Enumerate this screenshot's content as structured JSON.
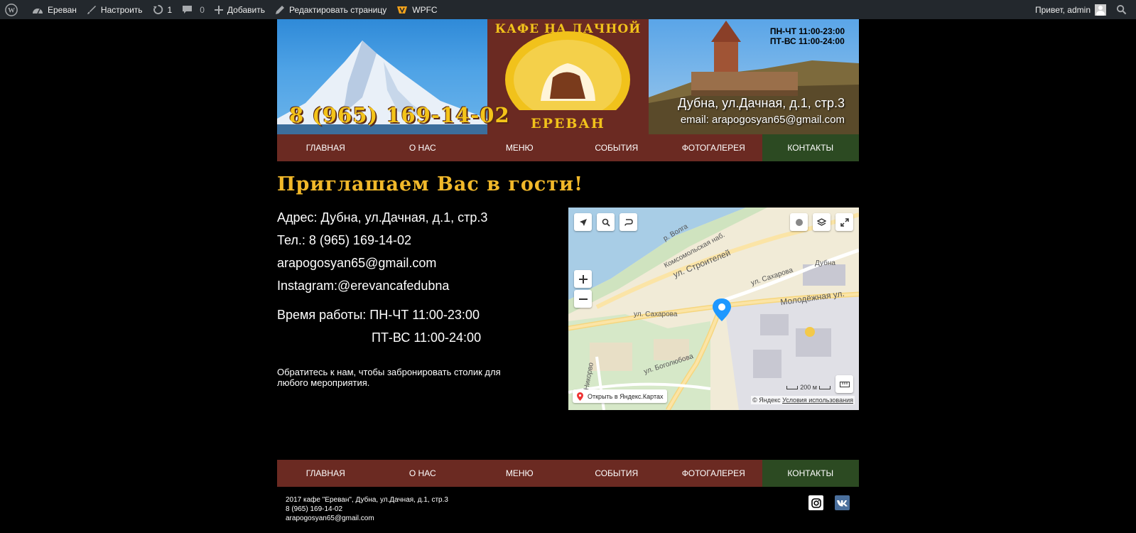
{
  "adminbar": {
    "site_name": "Ереван",
    "customize": "Настроить",
    "updates": "1",
    "comments": "0",
    "add_new": "Добавить",
    "edit_page": "Редактировать страницу",
    "plugin": "WPFC",
    "greeting": "Привет, admin"
  },
  "header": {
    "phone": "8 (965) 169-14-02",
    "hours_weekdays": "ПН-ЧТ 11:00-23:00",
    "hours_weekend": "ПТ-ВС 11:00-24:00",
    "address": "Дубна, ул.Дачная, д.1, стр.3",
    "email": "email: arapogosyan65@gmail.com",
    "emblem_title": "КАФЕ НА ДАЧНОЙ",
    "emblem_name": "ЕРЕВАН"
  },
  "nav": {
    "items": [
      "ГЛАВНАЯ",
      "О НАС",
      "МЕНЮ",
      "СОБЫТИЯ",
      "ФОТОГАЛЕРЕЯ",
      "КОНТАКТЫ"
    ],
    "active": "КОНТАКТЫ"
  },
  "content": {
    "heading": "Приглашаем Вас в гости!",
    "address": "Адрес: Дубна, ул.Дачная, д.1, стр.3",
    "phone": "Тел.: 8 (965) 169-14-02",
    "email": "arapogosyan65@gmail.com",
    "instagram": "Instagram:@erevancafedubna",
    "hours_line1": "Время работы: ПН-ЧТ 11:00-23:00",
    "hours_line2": "ПТ-ВС 11:00-24:00",
    "note": "Обратитесь к нам, чтобы забронировать столик для любого мероприятия."
  },
  "map": {
    "labels": {
      "komsomolskaya": "Комсомольская наб.",
      "stroiteley": "ул. Строителей",
      "sakharova_top": "ул. Сахарова",
      "molodezhnaya": "Молодёжная ул.",
      "sakharova_left": "ул. Сахарова",
      "bogolyubova": "ул. Боголюбова",
      "dubna": "Дубна",
      "volga": "р. Волга",
      "side_street": "ул. Никорво"
    },
    "open_link": "Открыть в Яндекс.Картах",
    "copyright_prefix": "© Яндекс",
    "terms": "Условия использования",
    "scale": "200 м"
  },
  "footer": {
    "line1": "2017 кафе \"Ереван\", Дубна, ул.Дачная, д.1, стр.3",
    "line2": "8 (965) 169-14-02",
    "line3": "arapogosyan65@gmail.com"
  },
  "colors": {
    "adminbar": "#23282d",
    "nav": "#6b2a22",
    "nav_active": "#2c4a22",
    "heading": "#f1b82a",
    "emblem_gold": "#f1c21b"
  }
}
